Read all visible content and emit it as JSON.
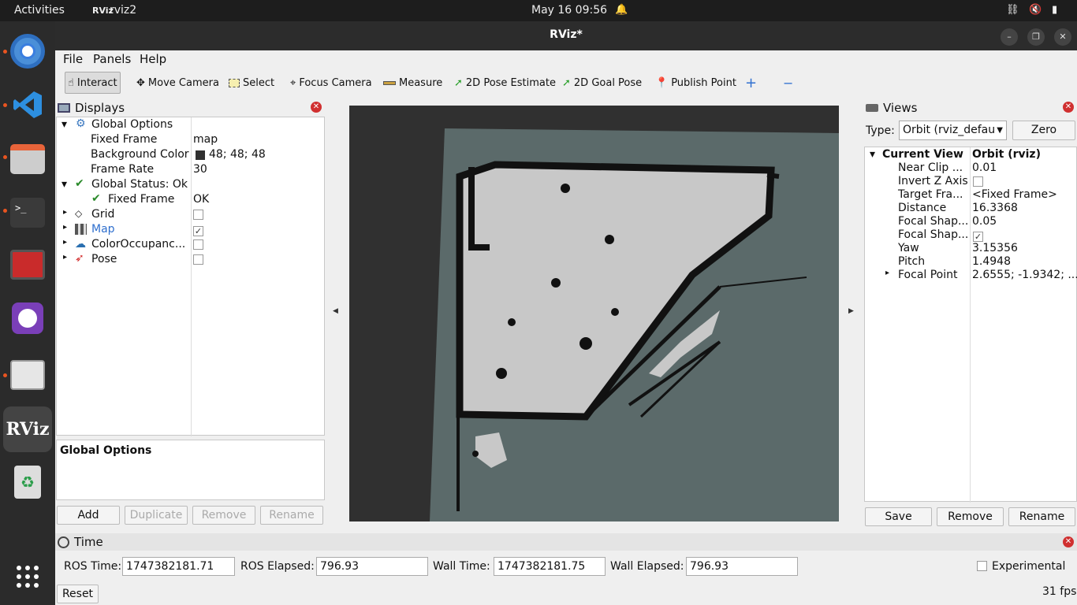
{
  "topbar": {
    "activities": "Activities",
    "app_name": "rviz2",
    "clock": "May 16  09:56"
  },
  "window": {
    "title": "RViz*"
  },
  "menu": {
    "file": "File",
    "panels": "Panels",
    "help": "Help"
  },
  "toolbar": {
    "interact": "Interact",
    "move_camera": "Move Camera",
    "select": "Select",
    "focus_camera": "Focus Camera",
    "measure": "Measure",
    "pose_estimate": "2D Pose Estimate",
    "goal_pose": "2D Goal Pose",
    "publish_point": "Publish Point",
    "plus": "+",
    "minus": "−"
  },
  "displays": {
    "title": "Displays",
    "rows": [
      {
        "label": "Global Options",
        "value": ""
      },
      {
        "label": "Fixed Frame",
        "value": "map"
      },
      {
        "label": "Background Color",
        "value": "48; 48; 48"
      },
      {
        "label": "Frame Rate",
        "value": "30"
      },
      {
        "label": "Global Status: Ok",
        "value": ""
      },
      {
        "label": "Fixed Frame",
        "value": "OK"
      },
      {
        "label": "Grid",
        "value": ""
      },
      {
        "label": "Map",
        "value": ""
      },
      {
        "label": "ColorOccupanc...",
        "value": ""
      },
      {
        "label": "Pose",
        "value": ""
      }
    ],
    "desc_title": "Global Options",
    "buttons": {
      "add": "Add",
      "duplicate": "Duplicate",
      "remove": "Remove",
      "rename": "Rename"
    }
  },
  "views": {
    "title": "Views",
    "type_label": "Type:",
    "type_value": "Orbit (rviz_defau",
    "zero": "Zero",
    "header_left": "Current View",
    "header_right": "Orbit (rviz)",
    "rows": [
      {
        "label": "Near Clip ...",
        "value": "0.01"
      },
      {
        "label": "Invert Z Axis",
        "value": ""
      },
      {
        "label": "Target Fra...",
        "value": "<Fixed Frame>"
      },
      {
        "label": "Distance",
        "value": "16.3368"
      },
      {
        "label": "Focal Shap...",
        "value": "0.05"
      },
      {
        "label": "Focal Shap...",
        "value": ""
      },
      {
        "label": "Yaw",
        "value": "3.15356"
      },
      {
        "label": "Pitch",
        "value": "1.4948"
      },
      {
        "label": "Focal Point",
        "value": "2.6555; -1.9342; ..."
      }
    ],
    "buttons": {
      "save": "Save",
      "remove": "Remove",
      "rename": "Rename"
    }
  },
  "time": {
    "title": "Time",
    "ros_time_label": "ROS Time:",
    "ros_time": "1747382181.71",
    "ros_elapsed_label": "ROS Elapsed:",
    "ros_elapsed": "796.93",
    "wall_time_label": "Wall Time:",
    "wall_time": "1747382181.75",
    "wall_elapsed_label": "Wall Elapsed:",
    "wall_elapsed": "796.93",
    "experimental": "Experimental",
    "reset": "Reset",
    "fps": "31 fps"
  },
  "dock": {
    "rviz_label": "RViz"
  },
  "colors": {
    "background": "#303030",
    "map_free": "#c8c8c8",
    "map_unknown": "#5a6a6a",
    "accent": "#e95420"
  }
}
